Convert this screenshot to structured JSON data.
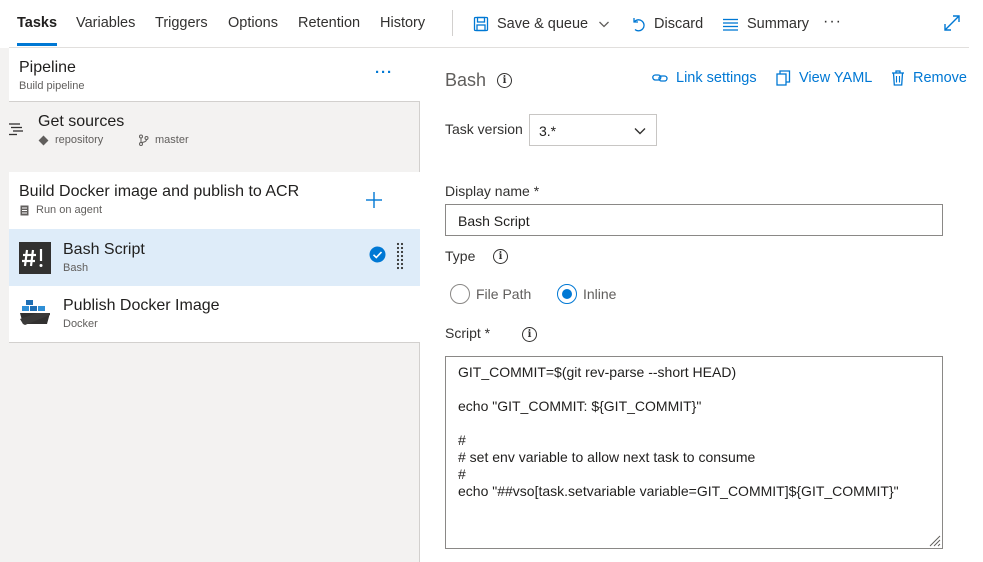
{
  "tabs": [
    {
      "label": "Tasks",
      "active": true
    },
    {
      "label": "Variables"
    },
    {
      "label": "Triggers"
    },
    {
      "label": "Options"
    },
    {
      "label": "Retention"
    },
    {
      "label": "History"
    }
  ],
  "toolbar": {
    "save_queue": "Save & queue",
    "discard": "Discard",
    "summary": "Summary",
    "more": "···"
  },
  "pipeline": {
    "title": "Pipeline",
    "subtitle": "Build pipeline",
    "more": "···"
  },
  "get_sources": {
    "title": "Get sources",
    "repository": "repository",
    "branch": "master"
  },
  "job": {
    "title": "Build Docker image and publish to ACR",
    "subtitle": "Run on agent"
  },
  "tasks": [
    {
      "title": "Bash Script",
      "subtitle": "Bash",
      "selected": true
    },
    {
      "title": "Publish Docker Image",
      "subtitle": "Docker"
    }
  ],
  "detail": {
    "title": "Bash",
    "link_settings": "Link settings",
    "view_yaml": "View YAML",
    "remove": "Remove",
    "task_version_label": "Task version",
    "task_version_value": "3.*",
    "display_name_label": "Display name *",
    "display_name_value": "Bash Script",
    "type_label": "Type",
    "type_options": [
      "File Path",
      "Inline"
    ],
    "type_selected": "Inline",
    "script_label": "Script *",
    "script_value": "GIT_COMMIT=$(git rev-parse --short HEAD)\n\necho \"GIT_COMMIT: ${GIT_COMMIT}\"\n\n#\n# set env variable to allow next task to consume\n#\necho \"##vso[task.setvariable variable=GIT_COMMIT]${GIT_COMMIT}\""
  },
  "colors": {
    "accent": "#0078d4",
    "selected_row": "#deecf9",
    "panel_bg": "#f3f2f1"
  }
}
